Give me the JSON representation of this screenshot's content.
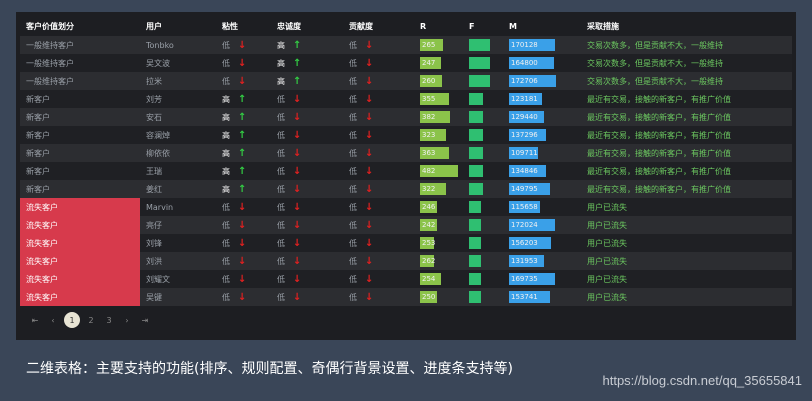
{
  "headers": {
    "segment": "客户价值划分",
    "user": "用户",
    "stickiness": "粘性",
    "loyalty": "忠诚度",
    "contribution": "贡献度",
    "r": "R",
    "f": "F",
    "m": "M",
    "action": "采取措施"
  },
  "rows": [
    {
      "segment": "一般维持客户",
      "user": "Tonbko",
      "stickiness": "低",
      "stick_dir": "down",
      "loyalty": "高",
      "loyal_dir": "up",
      "contribution": "低",
      "contrib_dir": "down",
      "r": 265,
      "r_pct": 0.6,
      "f": "",
      "f_pct": 0.55,
      "m": "170128",
      "m_pct": 0.68,
      "action": "交易次数多，但是贡献不大，一般维持",
      "lost": false
    },
    {
      "segment": "一般维持客户",
      "user": "吴文波",
      "stickiness": "低",
      "stick_dir": "down",
      "loyalty": "高",
      "loyal_dir": "up",
      "contribution": "低",
      "contrib_dir": "down",
      "r": 247,
      "r_pct": 0.55,
      "f": "",
      "f_pct": 0.55,
      "m": "164800",
      "m_pct": 0.66,
      "action": "交易次数多，但是贡献不大，一般维持",
      "lost": false
    },
    {
      "segment": "一般维持客户",
      "user": "拉米",
      "stickiness": "低",
      "stick_dir": "down",
      "loyalty": "高",
      "loyal_dir": "up",
      "contribution": "低",
      "contrib_dir": "down",
      "r": 260,
      "r_pct": 0.58,
      "f": "",
      "f_pct": 0.55,
      "m": "172706",
      "m_pct": 0.69,
      "action": "交易次数多，但是贡献不大，一般维持",
      "lost": false
    },
    {
      "segment": "新客户",
      "user": "刘芳",
      "stickiness": "高",
      "stick_dir": "up",
      "loyalty": "低",
      "loyal_dir": "down",
      "contribution": "低",
      "contrib_dir": "down",
      "r": 355,
      "r_pct": 0.75,
      "f": "",
      "f_pct": 0.38,
      "m": "123181",
      "m_pct": 0.48,
      "action": "最近有交易，接触的新客户，有推广价值",
      "lost": false
    },
    {
      "segment": "新客户",
      "user": "安石",
      "stickiness": "高",
      "stick_dir": "up",
      "loyalty": "低",
      "loyal_dir": "down",
      "contribution": "低",
      "contrib_dir": "down",
      "r": 382,
      "r_pct": 0.8,
      "f": "",
      "f_pct": 0.38,
      "m": "129440",
      "m_pct": 0.52,
      "action": "最近有交易，接触的新客户，有推广价值",
      "lost": false
    },
    {
      "segment": "新客户",
      "user": "容澜焯",
      "stickiness": "高",
      "stick_dir": "up",
      "loyalty": "低",
      "loyal_dir": "down",
      "contribution": "低",
      "contrib_dir": "down",
      "r": 323,
      "r_pct": 0.68,
      "f": "",
      "f_pct": 0.38,
      "m": "137296",
      "m_pct": 0.55,
      "action": "最近有交易，接触的新客户，有推广价值",
      "lost": false
    },
    {
      "segment": "新客户",
      "user": "柳依依",
      "stickiness": "高",
      "stick_dir": "up",
      "loyalty": "低",
      "loyal_dir": "down",
      "contribution": "低",
      "contrib_dir": "down",
      "r": 363,
      "r_pct": 0.76,
      "f": "",
      "f_pct": 0.38,
      "m": "109711",
      "m_pct": 0.42,
      "action": "最近有交易，接触的新客户，有推广价值",
      "lost": false
    },
    {
      "segment": "新客户",
      "user": "王瑞",
      "stickiness": "高",
      "stick_dir": "up",
      "loyalty": "低",
      "loyal_dir": "down",
      "contribution": "低",
      "contrib_dir": "down",
      "r": 482,
      "r_pct": 1.0,
      "f": "",
      "f_pct": 0.38,
      "m": "134846",
      "m_pct": 0.54,
      "action": "最近有交易，接触的新客户，有推广价值",
      "lost": false
    },
    {
      "segment": "新客户",
      "user": "姜红",
      "stickiness": "高",
      "stick_dir": "up",
      "loyalty": "低",
      "loyal_dir": "down",
      "contribution": "低",
      "contrib_dir": "down",
      "r": 322,
      "r_pct": 0.68,
      "f": "",
      "f_pct": 0.38,
      "m": "149795",
      "m_pct": 0.6,
      "action": "最近有交易，接触的新客户，有推广价值",
      "lost": false
    },
    {
      "segment": "流失客户",
      "user": "Marvin",
      "stickiness": "低",
      "stick_dir": "down",
      "loyalty": "低",
      "loyal_dir": "down",
      "contribution": "低",
      "contrib_dir": "down",
      "r": 246,
      "r_pct": 0.45,
      "f": "",
      "f_pct": 0.32,
      "m": "115658",
      "m_pct": 0.45,
      "action": "用户已流失",
      "lost": true
    },
    {
      "segment": "流失客户",
      "user": "亮仔",
      "stickiness": "低",
      "stick_dir": "down",
      "loyalty": "低",
      "loyal_dir": "down",
      "contribution": "低",
      "contrib_dir": "down",
      "r": 242,
      "r_pct": 0.45,
      "f": "",
      "f_pct": 0.32,
      "m": "172024",
      "m_pct": 0.68,
      "action": "用户已流失",
      "lost": true
    },
    {
      "segment": "流失客户",
      "user": "刘锋",
      "stickiness": "低",
      "stick_dir": "down",
      "loyalty": "低",
      "loyal_dir": "down",
      "contribution": "低",
      "contrib_dir": "down",
      "r": 253,
      "r_pct": 0.38,
      "f": "",
      "f_pct": 0.32,
      "m": "156203",
      "m_pct": 0.62,
      "action": "用户已流失",
      "lost": true
    },
    {
      "segment": "流失客户",
      "user": "刘洪",
      "stickiness": "低",
      "stick_dir": "down",
      "loyalty": "低",
      "loyal_dir": "down",
      "contribution": "低",
      "contrib_dir": "down",
      "r": 262,
      "r_pct": 0.38,
      "f": "",
      "f_pct": 0.32,
      "m": "131953",
      "m_pct": 0.52,
      "action": "用户已流失",
      "lost": true
    },
    {
      "segment": "流失客户",
      "user": "刘耀文",
      "stickiness": "低",
      "stick_dir": "down",
      "loyalty": "低",
      "loyal_dir": "down",
      "contribution": "低",
      "contrib_dir": "down",
      "r": 254,
      "r_pct": 0.55,
      "f": "",
      "f_pct": 0.32,
      "m": "169735",
      "m_pct": 0.67,
      "action": "用户已流失",
      "lost": true
    },
    {
      "segment": "流失客户",
      "user": "吴键",
      "stickiness": "低",
      "stick_dir": "down",
      "loyalty": "低",
      "loyal_dir": "down",
      "contribution": "低",
      "contrib_dir": "down",
      "r": 250,
      "r_pct": 0.45,
      "f": "",
      "f_pct": 0.32,
      "m": "153741",
      "m_pct": 0.6,
      "action": "用户已流失",
      "lost": true
    }
  ],
  "pagination": {
    "first": "⇤",
    "prev": "‹",
    "pages": [
      "1",
      "2",
      "3"
    ],
    "current": "1",
    "next": "›",
    "last": "⇥"
  },
  "caption": "二维表格：主要支持的功能(排序、规则配置、奇偶行背景设置、进度条支持等)",
  "watermark": "https://blog.csdn.net/qq_35655841",
  "colors": {
    "background": "#3a4658",
    "panel": "#1d1e22",
    "lost_segment": "#d73a4c",
    "bar_r": "#8bc34a",
    "bar_f": "#2fbf71",
    "bar_m": "#3aa0e8",
    "action_text": "#6cc860"
  }
}
